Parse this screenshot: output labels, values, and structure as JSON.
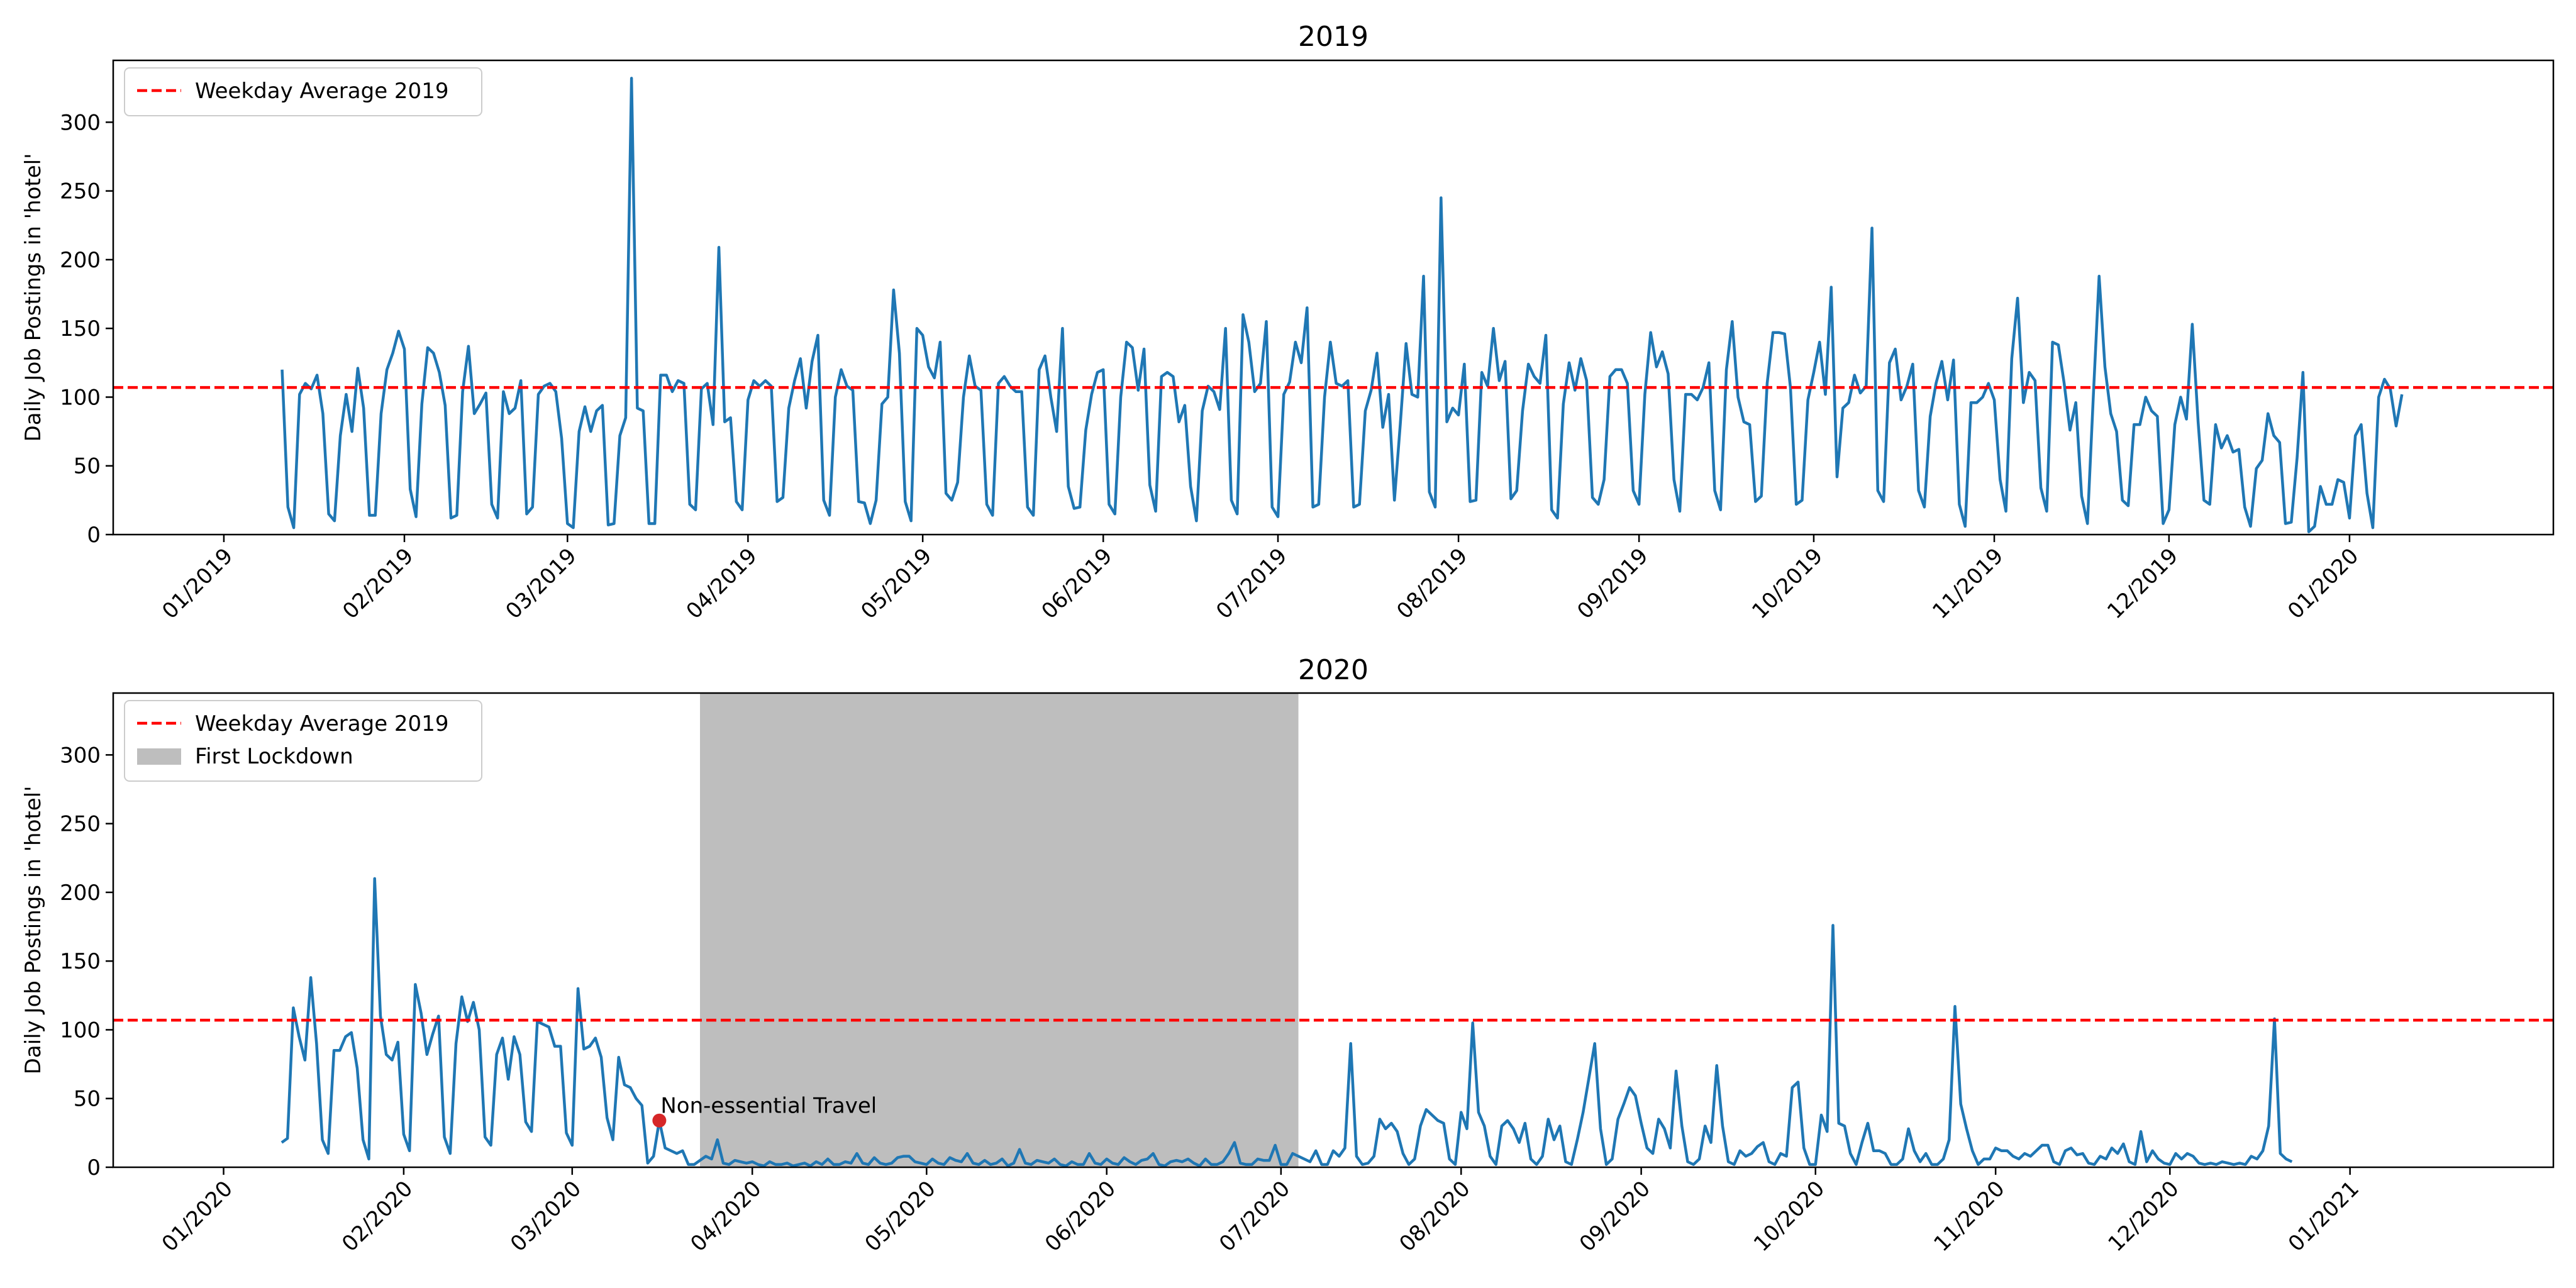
{
  "chart_data": [
    {
      "type": "line",
      "title": "2019",
      "ylabel": "Daily Job Postings in 'hotel'",
      "xlabel": "",
      "x_range": [
        "2018-12-13",
        "2020-02-05"
      ],
      "ylim": [
        0,
        345
      ],
      "yticks": [
        0,
        50,
        100,
        150,
        200,
        250,
        300
      ],
      "xtick_dates": [
        "2019-01-01",
        "2019-02-01",
        "2019-03-01",
        "2019-04-01",
        "2019-05-01",
        "2019-06-01",
        "2019-07-01",
        "2019-08-01",
        "2019-09-01",
        "2019-10-01",
        "2019-11-01",
        "2019-12-01",
        "2020-01-01"
      ],
      "xtick_labels": [
        "01/2019",
        "02/2019",
        "03/2019",
        "04/2019",
        "05/2019",
        "06/2019",
        "07/2019",
        "08/2019",
        "09/2019",
        "10/2019",
        "11/2019",
        "12/2019",
        "01/2020"
      ],
      "grid": false,
      "legend_placement": "top-left",
      "hline": {
        "value": 107,
        "name": "Weekday Average 2019",
        "color": "#ff0000",
        "style": "dashed"
      },
      "series": [
        {
          "color": "#1f77b4",
          "start": "2019-01-11",
          "values": [
            120,
            20,
            5,
            102,
            110,
            106,
            116,
            88,
            15,
            10,
            72,
            102,
            75,
            121,
            92,
            14,
            14,
            88,
            120,
            132,
            148,
            135,
            33,
            13,
            95,
            136,
            132,
            118,
            94,
            12,
            14,
            104,
            137,
            88,
            95,
            103,
            22,
            12,
            104,
            88,
            92,
            112,
            15,
            20,
            102,
            108,
            110,
            104,
            70,
            8,
            5,
            75,
            93,
            75,
            90,
            94,
            7,
            8,
            72,
            85,
            332,
            92,
            90,
            8,
            8,
            116,
            116,
            104,
            112,
            110,
            22,
            18,
            106,
            110,
            80,
            209,
            82,
            85,
            24,
            18,
            98,
            112,
            108,
            112,
            108,
            24,
            27,
            92,
            112,
            128,
            92,
            126,
            145,
            25,
            14,
            100,
            120,
            108,
            105,
            24,
            23,
            8,
            25,
            95,
            100,
            178,
            132,
            24,
            10,
            150,
            145,
            122,
            114,
            140,
            30,
            25,
            38,
            100,
            130,
            108,
            105,
            22,
            14,
            110,
            115,
            108,
            104,
            104,
            20,
            14,
            120,
            130,
            100,
            75,
            150,
            35,
            19,
            20,
            76,
            102,
            118,
            120,
            22,
            15,
            100,
            140,
            136,
            105,
            135,
            36,
            17,
            115,
            118,
            115,
            82,
            94,
            35,
            10,
            90,
            108,
            104,
            91,
            150,
            25,
            15,
            160,
            140,
            104,
            110,
            155,
            20,
            13,
            102,
            111,
            140,
            125,
            165,
            20,
            22,
            100,
            140,
            110,
            108,
            112,
            20,
            22,
            90,
            105,
            132,
            78,
            102,
            25,
            80,
            139,
            102,
            100,
            188,
            31,
            20,
            245,
            82,
            92,
            87,
            124,
            24,
            25,
            118,
            108,
            150,
            112,
            126,
            26,
            32,
            90,
            124,
            115,
            110,
            145,
            18,
            12,
            95,
            125,
            105,
            128,
            112,
            27,
            22,
            40,
            115,
            120,
            120,
            110,
            32,
            22,
            102,
            147,
            122,
            133,
            117,
            40,
            17,
            102,
            102,
            98,
            107,
            125,
            32,
            18,
            120,
            155,
            100,
            82,
            80,
            24,
            28,
            110,
            147,
            147,
            146,
            107,
            22,
            25,
            98,
            118,
            140,
            102,
            180,
            42,
            92,
            96,
            116,
            103,
            108,
            223,
            32,
            24,
            125,
            135,
            98,
            108,
            124,
            32,
            20,
            86,
            110,
            126,
            98,
            127,
            22,
            6,
            96,
            96,
            100,
            110,
            98,
            40,
            17,
            128,
            172,
            96,
            118,
            112,
            34,
            17,
            140,
            138,
            110,
            76,
            96,
            28,
            8,
            100,
            188,
            122,
            88,
            75,
            25,
            21,
            80,
            80,
            100,
            90,
            86,
            8,
            18,
            80,
            100,
            84,
            153,
            82,
            25,
            22,
            80,
            63,
            72,
            60,
            62,
            20,
            6,
            48,
            54,
            88,
            72,
            67,
            8,
            9,
            56,
            118,
            2,
            6,
            35,
            22,
            22,
            40,
            38,
            12,
            72,
            80,
            30,
            5,
            100,
            113,
            106,
            79,
            102
          ],
          "values_note_removed": true
        }
      ]
    },
    {
      "type": "line",
      "title": "2020",
      "ylabel": "Daily Job Postings in 'hotel'",
      "xlabel": "",
      "x_range": [
        "2019-12-13",
        "2021-02-05"
      ],
      "ylim": [
        0,
        345
      ],
      "yticks": [
        0,
        50,
        100,
        150,
        200,
        250,
        300
      ],
      "xtick_dates": [
        "2020-01-01",
        "2020-02-01",
        "2020-03-01",
        "2020-04-01",
        "2020-05-01",
        "2020-06-01",
        "2020-07-01",
        "2020-08-01",
        "2020-09-01",
        "2020-10-01",
        "2020-11-01",
        "2020-12-01",
        "2021-01-01"
      ],
      "xtick_labels": [
        "01/2020",
        "02/2020",
        "03/2020",
        "04/2020",
        "05/2020",
        "06/2020",
        "07/2020",
        "08/2020",
        "09/2020",
        "10/2020",
        "11/2020",
        "12/2020",
        "01/2021"
      ],
      "grid": false,
      "legend_placement": "top-left",
      "hline": {
        "value": 107,
        "name": "Weekday Average 2019",
        "color": "#ff0000",
        "style": "dashed"
      },
      "span": {
        "start": "2020-03-23",
        "end": "2020-07-04",
        "name": "First Lockdown",
        "color": "#bebebe"
      },
      "annotation": {
        "date": "2020-03-16",
        "value": 34,
        "text": "Non-essential Travel",
        "color": "#d62728"
      },
      "series": [
        {
          "color": "#1f77b4",
          "start": "2020-01-11",
          "values": [
            18,
            21,
            116,
            95,
            78,
            138,
            90,
            20,
            10,
            85,
            85,
            95,
            98,
            72,
            20,
            6,
            210,
            110,
            82,
            78,
            91,
            24,
            12,
            133,
            112,
            82,
            97,
            110,
            22,
            10,
            90,
            124,
            106,
            120,
            100,
            22,
            16,
            82,
            94,
            64,
            95,
            82,
            33,
            26,
            106,
            104,
            102,
            88,
            88,
            25,
            16,
            130,
            86,
            88,
            94,
            80,
            36,
            20,
            80,
            60,
            58,
            50,
            45,
            3,
            8,
            34,
            14,
            12,
            10,
            12,
            2,
            2,
            5,
            8,
            6,
            20,
            3,
            2,
            5,
            4,
            3,
            4,
            2,
            1,
            4,
            2,
            2,
            3,
            1,
            2,
            3,
            1,
            4,
            2,
            6,
            2,
            2,
            4,
            3,
            10,
            3,
            2,
            7,
            3,
            2,
            3,
            7,
            8,
            8,
            4,
            3,
            2,
            6,
            3,
            2,
            7,
            5,
            4,
            10,
            3,
            2,
            5,
            2,
            3,
            6,
            1,
            3,
            13,
            3,
            2,
            5,
            4,
            3,
            6,
            2,
            1,
            4,
            2,
            2,
            10,
            3,
            2,
            6,
            3,
            2,
            7,
            4,
            2,
            5,
            6,
            10,
            2,
            1,
            4,
            5,
            4,
            6,
            3,
            1,
            6,
            2,
            2,
            4,
            10,
            18,
            3,
            2,
            2,
            6,
            5,
            5,
            16,
            2,
            2,
            10,
            8,
            6,
            4,
            12,
            2,
            2,
            12,
            8,
            14,
            90,
            8,
            2,
            3,
            8,
            35,
            28,
            32,
            26,
            10,
            2,
            6,
            30,
            42,
            38,
            34,
            32,
            6,
            2,
            40,
            28,
            105,
            40,
            30,
            8,
            2,
            30,
            34,
            28,
            18,
            32,
            6,
            2,
            8,
            35,
            20,
            30,
            4,
            2,
            20,
            40,
            65,
            90,
            28,
            2,
            6,
            35,
            46,
            58,
            52,
            32,
            14,
            10,
            35,
            28,
            14,
            70,
            30,
            4,
            2,
            6,
            30,
            18,
            74,
            30,
            4,
            2,
            12,
            8,
            10,
            15,
            18,
            4,
            2,
            10,
            8,
            58,
            62,
            14,
            2,
            2,
            38,
            26,
            176,
            32,
            30,
            10,
            2,
            18,
            32,
            12,
            12,
            10,
            2,
            2,
            6,
            28,
            12,
            4,
            10,
            2,
            2,
            6,
            20,
            117,
            46,
            28,
            12,
            2,
            6,
            6,
            14,
            12,
            12,
            8,
            6,
            10,
            8,
            12,
            16,
            16,
            4,
            2,
            12,
            14,
            9,
            10,
            3,
            2,
            8,
            6,
            14,
            10,
            17,
            4,
            2,
            26,
            4,
            12,
            6,
            3,
            2,
            10,
            6,
            10,
            8,
            3,
            2,
            3,
            2,
            4,
            3,
            2,
            3,
            2,
            8,
            6,
            12,
            30,
            108,
            10,
            6,
            4
          ]
        }
      ]
    }
  ]
}
